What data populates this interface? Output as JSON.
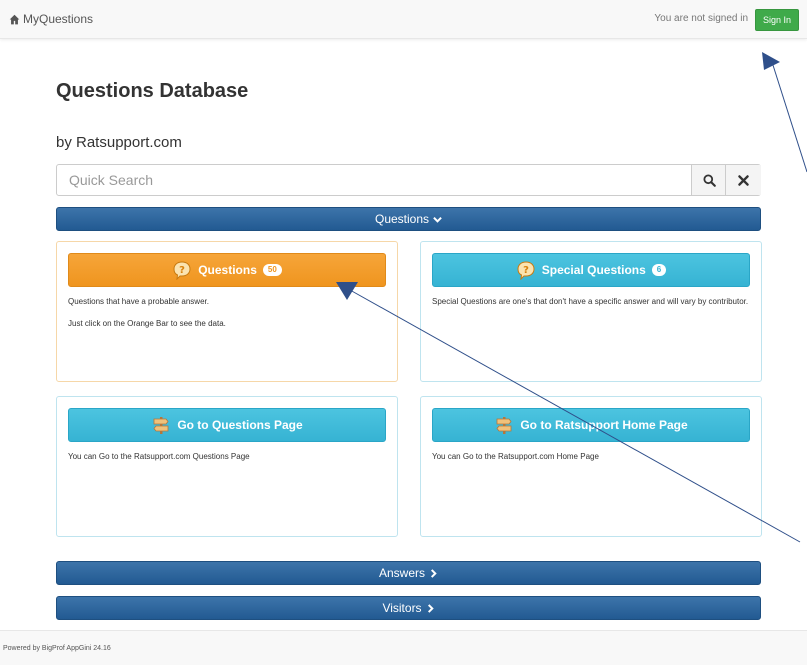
{
  "navbar": {
    "brand": "MyQuestions",
    "signed_status": "You are not signed in",
    "signin_label": "Sign In"
  },
  "page": {
    "title": "Questions Database",
    "subtitle": "by Ratsupport.com"
  },
  "search": {
    "placeholder": "Quick Search",
    "value": ""
  },
  "groups": {
    "questions": "Questions",
    "answers": "Answers",
    "visitors": "Visitors"
  },
  "cards": [
    {
      "label": "Questions",
      "count": "50",
      "icon": "question-bubble-icon",
      "color": "#ef951f",
      "description": [
        "Questions that have a probable answer.",
        "Just click on the Orange Bar to see the data."
      ]
    },
    {
      "label": "Special Questions",
      "count": "6",
      "icon": "question-bubble-icon",
      "color": "#36b3d3",
      "description": [
        "Special Questions are one's that don't have a specific answer and will vary by contributor."
      ]
    },
    {
      "label": "Go to Questions Page",
      "icon": "signpost-icon",
      "color": "#36b3d3",
      "description": [
        "You can Go to the Ratsupport.com Questions Page"
      ]
    },
    {
      "label": "Go to Ratsupport Home Page",
      "icon": "signpost-icon",
      "color": "#36b3d3",
      "description": [
        "You can Go to the Ratsupport.com Home Page"
      ]
    }
  ],
  "footer": {
    "text": "Powered by BigProf AppGini 24.16"
  },
  "colors": {
    "group_bar": "#225a92",
    "signin": "#3faa4a",
    "arrow": "#2f4f8a"
  }
}
